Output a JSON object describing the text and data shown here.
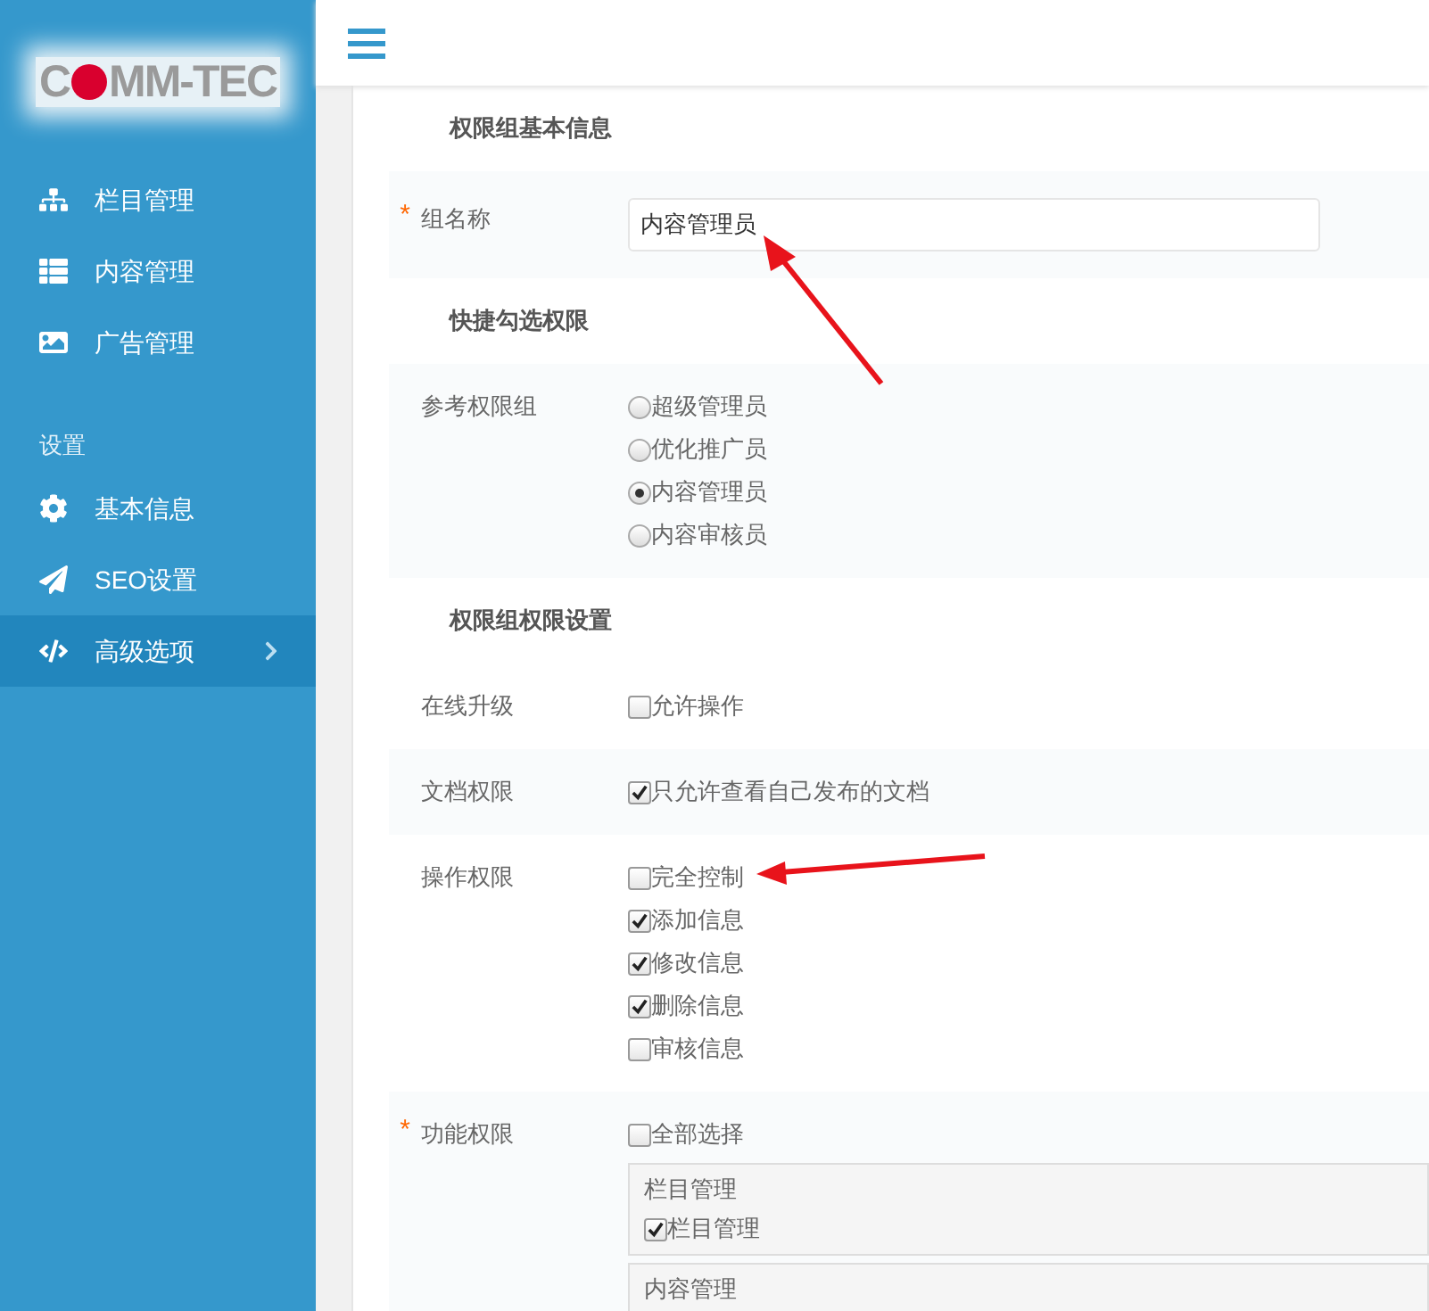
{
  "sidebar": {
    "logo": {
      "before": "C",
      "after": "MM-TEC"
    },
    "groups": [
      {
        "items": [
          {
            "label": "栏目管理",
            "selected": false,
            "expandable": false
          },
          {
            "label": "内容管理",
            "selected": false,
            "expandable": false
          },
          {
            "label": "广告管理",
            "selected": false,
            "expandable": false
          }
        ]
      },
      {
        "title": "设置",
        "items": [
          {
            "label": "基本信息",
            "selected": false,
            "expandable": false
          },
          {
            "label": "SEO设置",
            "selected": false,
            "expandable": false
          },
          {
            "label": "高级选项",
            "selected": true,
            "expandable": true
          }
        ]
      }
    ]
  },
  "sections": [
    {
      "title": "权限组基本信息",
      "rows": [
        {
          "kind": "input",
          "label": "组名称",
          "marker": "*",
          "value": "内容管理员"
        }
      ]
    },
    {
      "title": "快捷勾选权限",
      "rows": [
        {
          "kind": "radio",
          "label": "参考权限组",
          "options": [
            {
              "label": "超级管理员",
              "selected": false
            },
            {
              "label": "优化推广员",
              "selected": false
            },
            {
              "label": "内容管理员",
              "selected": true
            },
            {
              "label": "内容审核员",
              "selected": false
            }
          ]
        }
      ]
    },
    {
      "title": "权限组权限设置",
      "rows": [
        {
          "kind": "checkbox",
          "label": "在线升级",
          "options": [
            {
              "label": "允许操作",
              "checked": false
            }
          ]
        },
        {
          "kind": "checkbox",
          "label": "文档权限",
          "options": [
            {
              "label": "只允许查看自己发布的文档",
              "checked": true
            }
          ]
        },
        {
          "kind": "checkbox",
          "label": "操作权限",
          "options": [
            {
              "label": "完全控制",
              "checked": false
            },
            {
              "label": "添加信息",
              "checked": true
            },
            {
              "label": "修改信息",
              "checked": true
            },
            {
              "label": "删除信息",
              "checked": true
            },
            {
              "label": "审核信息",
              "checked": false
            }
          ]
        },
        {
          "kind": "groups",
          "label": "功能权限",
          "marker": "*",
          "options": [
            {
              "label": "全部选择",
              "checked": false
            }
          ],
          "groups": [
            {
              "title": "栏目管理",
              "options": [
                {
                  "label": "栏目管理",
                  "checked": true
                }
              ]
            },
            {
              "title": "内容管理"
            }
          ]
        }
      ]
    }
  ]
}
